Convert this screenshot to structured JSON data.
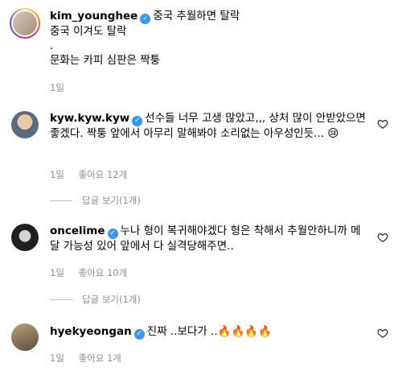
{
  "comments": [
    {
      "username": "kim_younghee",
      "lines": [
        "중국 추월하면 탈락",
        "중국 이겨도 탈락",
        ".",
        "문화는 카피 심판은 짝퉁"
      ],
      "time": "1일",
      "likes": "",
      "avatar_color": "#c9b8a8",
      "has_story": true
    },
    {
      "username": "kyw.kyw.kyw",
      "lines": [
        "선수들 너무 고생 많았고,,, 상처 많이 안받았으면 좋겠다. 짝퉁 앞에서 아무리 말해봐야 소리없는 아우성인듯... 😢"
      ],
      "time": "1일",
      "likes": "좋아요 12개",
      "reply_label": "답글 보기(1개)",
      "avatar_color": "#6b7a8f",
      "has_story": false
    },
    {
      "username": "oncelime",
      "lines": [
        "누나 형이 복귀해야겠다 형은 착해서 추월안하니까 메달 가능성 있어 앞에서 다 실격당해주면.."
      ],
      "time": "1일",
      "likes": "좋아요 10개",
      "reply_label": "답글 보기(1개)",
      "avatar_color": "#2b2b2b",
      "has_story": false
    },
    {
      "username": "hyekyeongan",
      "lines": [
        "진짜 ..보다가 ..🔥🔥🔥🔥"
      ],
      "time": "1일",
      "likes": "좋아요 1개",
      "avatar_color": "#7a6a52",
      "has_story": false
    }
  ],
  "icons": {
    "verified": "verified-check-icon",
    "heart": "heart-outline-icon"
  },
  "colors": {
    "verified": "#3897f0",
    "meta": "#8e8e8e"
  }
}
